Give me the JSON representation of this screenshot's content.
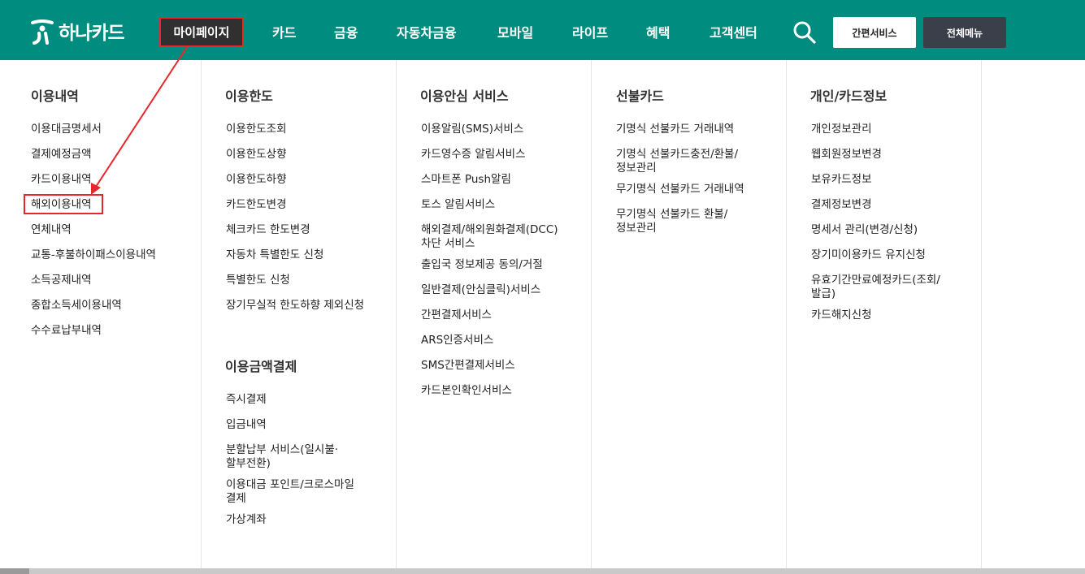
{
  "header": {
    "logo_text": "하나카드",
    "mypage_label": "마이페이지",
    "nav": [
      "카드",
      "금융",
      "자동차금융",
      "모바일",
      "라이프",
      "혜택",
      "고객센터"
    ],
    "quick_service_label": "간편서비스",
    "all_menu_label": "전체메뉴"
  },
  "menu": {
    "columns": [
      {
        "sections": [
          {
            "title": "이용내역",
            "items": [
              "이용대금명세서",
              "결제예정금액",
              "카드이용내역",
              "해외이용내역",
              "연체내역",
              "교통-후불하이패스이용내역",
              "소득공제내역",
              "종합소득세이용내역",
              "수수료납부내역"
            ]
          }
        ]
      },
      {
        "sections": [
          {
            "title": "이용한도",
            "items": [
              "이용한도조회",
              "이용한도상향",
              "이용한도하향",
              "카드한도변경",
              "체크카드 한도변경",
              "자동차 특별한도 신청",
              "특별한도 신청",
              "장기무실적 한도하향 제외신청"
            ]
          },
          {
            "title": "이용금액결제",
            "items": [
              "즉시결제",
              "입금내역",
              "분할납부 서비스(일시불·",
              "할부전환)",
              "이용대금 포인트/크로스마일",
              "결제",
              "가상계좌"
            ]
          }
        ]
      },
      {
        "sections": [
          {
            "title": "이용안심 서비스",
            "items": [
              "이용알림(SMS)서비스",
              "카드영수증 알림서비스",
              "스마트폰 Push알림",
              "토스 알림서비스",
              "해외결제/해외원화결제(DCC)",
              "차단 서비스",
              "출입국 정보제공 동의/거절",
              "일반결제(안심클릭)서비스",
              "간편결제서비스",
              "ARS인증서비스",
              "SMS간편결제서비스",
              "카드본인확인서비스"
            ]
          }
        ]
      },
      {
        "sections": [
          {
            "title": "선불카드",
            "items": [
              "기명식 선불카드 거래내역",
              "기명식 선불카드충전/환불/",
              "정보관리",
              "무기명식 선불카드 거래내역",
              "무기명식 선불카드 환불/",
              "정보관리"
            ]
          }
        ]
      },
      {
        "sections": [
          {
            "title": "개인/카드정보",
            "items": [
              "개인정보관리",
              "웹회원정보변경",
              "보유카드정보",
              "결제정보변경",
              "명세서 관리(변경/신청)",
              "장기미이용카드 유지신청",
              "유효기간만료예정카드(조회/",
              "발급)",
              "카드해지신청"
            ]
          }
        ]
      }
    ]
  },
  "colors": {
    "brand_green": "#008c7e",
    "highlight_red": "#e8262b",
    "mypage_bg": "#303030",
    "all_menu_bg": "#3a3f4a"
  },
  "icons": {
    "search": "search-icon",
    "logo": "hana-logo-icon"
  }
}
